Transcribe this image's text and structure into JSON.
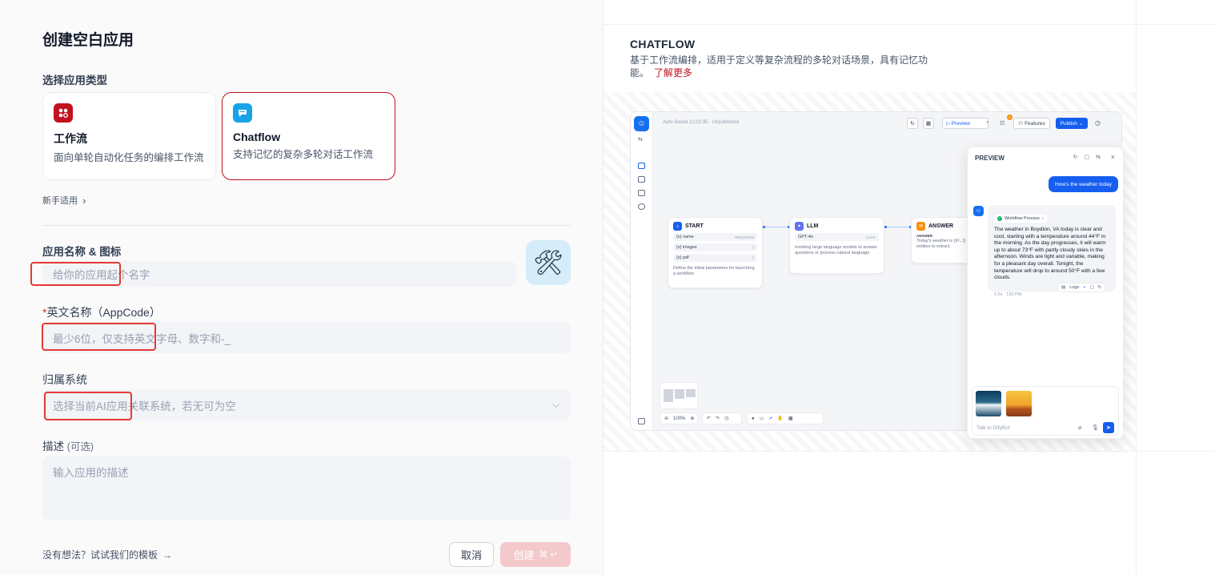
{
  "left": {
    "title": "创建空白应用",
    "type_section_label": "选择应用类型",
    "types": [
      {
        "name": "工作流",
        "desc": "面向单轮自动化任务的编排工作流",
        "icon": "workflow-icon",
        "color": "#c1121f",
        "selected": false
      },
      {
        "name": "Chatflow",
        "desc": "支持记忆的复杂多轮对话工作流",
        "icon": "chat-bubble-icon",
        "color": "#16a3e8",
        "selected": true
      }
    ],
    "beginner_label": "新手适用",
    "name_section_label": "应用名称 & 图标",
    "name_placeholder": "给你的应用起个名字",
    "app_icon": "🛠",
    "appcode_required_mark": "*",
    "appcode_label": "英文名称（AppCode）",
    "appcode_placeholder": "最少6位，仅支持英文字母、数字和-_",
    "system_label": "归属系统",
    "system_placeholder": "选择当前AI应用关联系统，若无可为空",
    "desc_label": "描述",
    "desc_optional": "(可选)",
    "desc_placeholder": "输入应用的描述",
    "template_link": "没有想法？试试我们的模板",
    "cancel_label": "取消",
    "create_label": "创建",
    "create_shortcut": "⌘ ↵",
    "accent_color": "#c1121f",
    "highlight_color": "#e53935"
  },
  "right": {
    "title": "CHATFLOW",
    "desc": "基于工作流编排，适用于定义等复杂流程的多轮对话场景，具有记忆功能。",
    "learn_more": "了解更多",
    "preview": {
      "autosave": "Auto-Saved 21:02:35 · Unpublished",
      "btn_preview": "▷ Preview",
      "btn_features": "Features",
      "btn_publish": "Publish ⌄",
      "badge_count": "2",
      "nodes": {
        "start": {
          "title": "START",
          "vars": [
            {
              "name": "{x} name",
              "tag": "REQUIRED"
            },
            {
              "name": "{x} images",
              "tag": ""
            },
            {
              "name": "{x} pdf",
              "tag": ""
            }
          ],
          "desc": "Define the initial parameters for launching a workflow"
        },
        "llm": {
          "title": "LLM",
          "model": "GPT-4o",
          "model_tag": "CHAT",
          "desc": "Invoking large language models to answer questions or process natural language"
        },
        "answer": {
          "title": "ANSWER",
          "label": "ANSWER",
          "desc": "Today's weather is {{#...}} entities to extract."
        }
      },
      "zoom": "100%",
      "panel": {
        "title": "PREVIEW",
        "user_msg": "How's the weather today",
        "workflow_process": "Workflow Process",
        "bot_text": "The weather in Boydton, VA today is clear and cool, starting with a temperature around 44°F in the morning. As the day progresses, it will warm up to about 73°F with partly cloudy skies in the afternoon. Winds are light and variable, making for a pleasant day overall. Tonight, the temperature will drop to around 50°F with a few clouds.",
        "logs": "Logs",
        "meta": "5.6s · 120 PM",
        "input_placeholder": "Talk to DifyBot"
      }
    }
  }
}
